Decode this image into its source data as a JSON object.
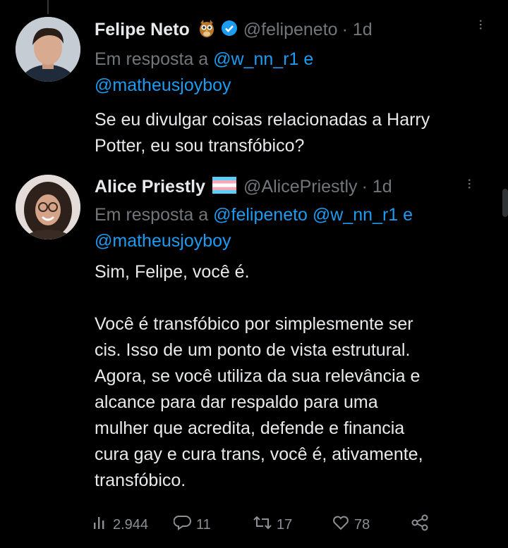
{
  "tweet1": {
    "name": "Felipe Neto",
    "handle": "@felipeneto",
    "time": "· 1d",
    "reply_prefix": "Em resposta a ",
    "mention_a": "@w_nn_r1",
    "connector": " e",
    "mention_b": "@matheusjoyboy",
    "text": "Se eu divulgar coisas relacionadas a Harry\nPotter, eu sou transfóbico?"
  },
  "tweet2": {
    "name": "Alice Priestly",
    "handle": "@AlicePriestly",
    "time": "· 1d",
    "reply_prefix": "Em resposta a ",
    "mention_a": "@felipeneto",
    "mention_b": "@w_nn_r1",
    "connector": " e",
    "mention_c": "@matheusjoyboy",
    "text": "Sim, Felipe, você é.\n\nVocê é transfóbico por simplesmente ser\ncis. Isso de um ponto de vista estrutural.\nAgora, se você utiliza da sua relevância e\nalcance para dar respaldo para uma\nmulher que acredita, defende e financia\ncura gay e cura trans, você é, ativamente,\ntransfóbico."
  },
  "actions": {
    "views": "2.944",
    "replies": "11",
    "retweets": "17",
    "likes": "78"
  },
  "icons": [
    "owl-emoji",
    "verified-badge",
    "trans-flag",
    "more-icon",
    "views-icon",
    "reply-icon",
    "retweet-icon",
    "like-icon",
    "share-icon"
  ],
  "colors": {
    "accent": "#1d9bf0",
    "background": "#000000",
    "muted": "#71767b"
  }
}
